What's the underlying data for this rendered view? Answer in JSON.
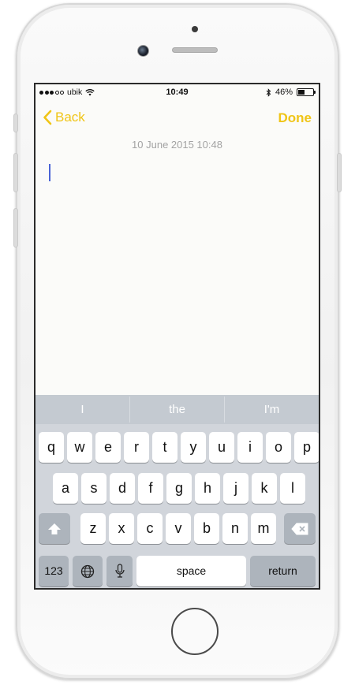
{
  "status_bar": {
    "signal_dots": 5,
    "signal_filled": 3,
    "carrier": "ubik",
    "time": "10:49",
    "battery_percent": "46%",
    "battery_level": 0.46
  },
  "navbar": {
    "back_label": "Back",
    "done_label": "Done",
    "accent_color": "#f0c517"
  },
  "note": {
    "date": "10 June 2015 10:48",
    "body": ""
  },
  "keyboard": {
    "suggestions": [
      "I",
      "the",
      "I'm"
    ],
    "row1": [
      "q",
      "w",
      "e",
      "r",
      "t",
      "y",
      "u",
      "i",
      "o",
      "p"
    ],
    "row2": [
      "a",
      "s",
      "d",
      "f",
      "g",
      "h",
      "j",
      "k",
      "l"
    ],
    "row3": [
      "z",
      "x",
      "c",
      "v",
      "b",
      "n",
      "m"
    ],
    "numbers_label": "123",
    "space_label": "space",
    "return_label": "return"
  }
}
